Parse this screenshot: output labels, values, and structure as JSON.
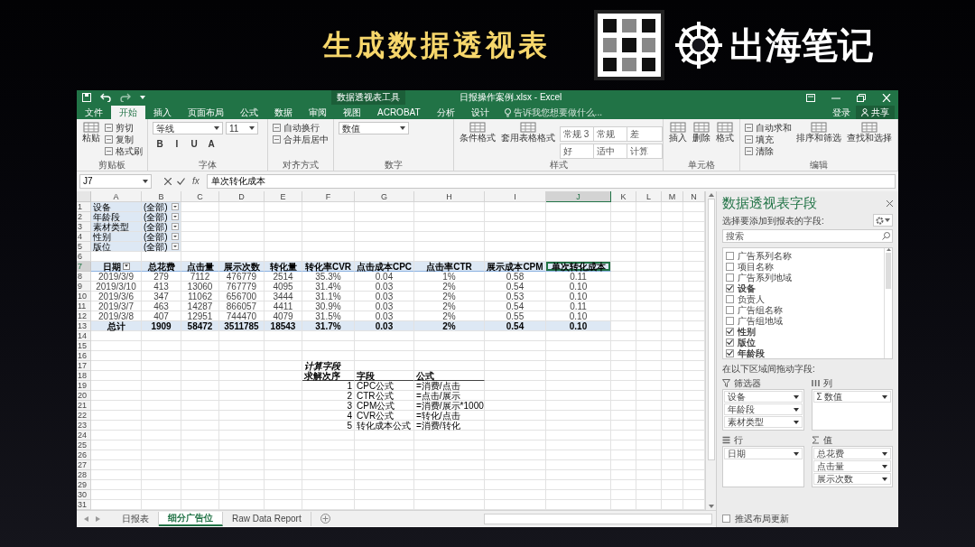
{
  "slide": {
    "title": "生成数据透视表",
    "logo_text": "出海笔记"
  },
  "window": {
    "context_group": "数据透视表工具",
    "title": "日报操作案例.xlsx - Excel"
  },
  "ribbon_tabs": [
    {
      "label": "文件",
      "selected": false
    },
    {
      "label": "开始",
      "selected": true
    },
    {
      "label": "插入",
      "selected": false
    },
    {
      "label": "页面布局",
      "selected": false
    },
    {
      "label": "公式",
      "selected": false
    },
    {
      "label": "数据",
      "selected": false
    },
    {
      "label": "审阅",
      "selected": false
    },
    {
      "label": "视图",
      "selected": false
    },
    {
      "label": "ACROBAT",
      "selected": false
    },
    {
      "label": "分析",
      "selected": false
    },
    {
      "label": "设计",
      "selected": false
    }
  ],
  "tell_me": {
    "placeholder": "告诉我您想要做什么..."
  },
  "account": {
    "sign_in": "登录",
    "share": "共享"
  },
  "ribbon_groups": [
    {
      "label": "剪贴板",
      "items": [
        {
          "kind": "large",
          "label": "粘贴"
        },
        {
          "kind": "small",
          "label": "剪切"
        },
        {
          "kind": "small",
          "label": "复制"
        },
        {
          "kind": "small",
          "label": "格式刷"
        }
      ]
    },
    {
      "label": "字体",
      "items": [
        {
          "kind": "field",
          "label": "等线"
        },
        {
          "kind": "field",
          "label": "11"
        },
        {
          "kind": "glyph",
          "label": "B"
        },
        {
          "kind": "glyph",
          "label": "I"
        },
        {
          "kind": "glyph",
          "label": "U"
        },
        {
          "kind": "glyph",
          "label": "A"
        }
      ]
    },
    {
      "label": "对齐方式",
      "items": [
        {
          "kind": "small",
          "label": "自动换行"
        },
        {
          "kind": "small",
          "label": "合并后居中"
        }
      ]
    },
    {
      "label": "数字",
      "items": [
        {
          "kind": "field",
          "label": "数值"
        }
      ]
    },
    {
      "label": "样式",
      "items": [
        {
          "kind": "large",
          "label": "条件格式"
        },
        {
          "kind": "large",
          "label": "套用表格格式"
        },
        {
          "kind": "style",
          "label": "常规 3"
        },
        {
          "kind": "style",
          "label": "常规"
        },
        {
          "kind": "style",
          "label": "差"
        },
        {
          "kind": "style",
          "label": "好"
        },
        {
          "kind": "style",
          "label": "适中"
        },
        {
          "kind": "style",
          "label": "计算"
        }
      ]
    },
    {
      "label": "单元格",
      "items": [
        {
          "kind": "large",
          "label": "插入"
        },
        {
          "kind": "large",
          "label": "删除"
        },
        {
          "kind": "large",
          "label": "格式"
        }
      ]
    },
    {
      "label": "编辑",
      "items": [
        {
          "kind": "small",
          "label": "自动求和"
        },
        {
          "kind": "small",
          "label": "填充"
        },
        {
          "kind": "small",
          "label": "清除"
        },
        {
          "kind": "large",
          "label": "排序和筛选"
        },
        {
          "kind": "large",
          "label": "查找和选择"
        }
      ]
    }
  ],
  "formula_bar": {
    "name_box": "J7",
    "fx": "fx",
    "value": "单次转化成本"
  },
  "sheet": {
    "column_headers": [
      "A",
      "B",
      "C",
      "D",
      "E",
      "F",
      "G",
      "H",
      "I",
      "J",
      "K",
      "L",
      "M",
      "N"
    ],
    "row_headers": [
      "1",
      "2",
      "3",
      "4",
      "5",
      "6",
      "7",
      "8",
      "9",
      "10",
      "11",
      "12",
      "13",
      "14",
      "15",
      "16",
      "17",
      "18",
      "19",
      "20",
      "21",
      "22",
      "23",
      "24",
      "25",
      "26",
      "27",
      "28",
      "29",
      "30",
      "31"
    ],
    "filters": [
      {
        "field": "设备",
        "value": "(全部)"
      },
      {
        "field": "年龄段",
        "value": "(全部)"
      },
      {
        "field": "素材类型",
        "value": "(全部)"
      },
      {
        "field": "性别",
        "value": "(全部)"
      },
      {
        "field": "版位",
        "value": "(全部)"
      }
    ],
    "pivot": {
      "columns": [
        {
          "label": "日期",
          "selected": false
        },
        {
          "label": "总花费",
          "selected": false
        },
        {
          "label": "点击量",
          "selected": false
        },
        {
          "label": "展示次数",
          "selected": false
        },
        {
          "label": "转化量",
          "selected": false
        },
        {
          "label": "转化率CVR",
          "selected": false
        },
        {
          "label": "点击成本CPC",
          "selected": false
        },
        {
          "label": "点击率CTR",
          "selected": false
        },
        {
          "label": "展示成本CPM",
          "selected": false
        },
        {
          "label": "单次转化成本",
          "selected": true
        }
      ],
      "rows": [
        [
          "2019/3/9",
          "279",
          "7112",
          "476779",
          "2514",
          "35.3%",
          "0.04",
          "1%",
          "0.58",
          "0.11"
        ],
        [
          "2019/3/10",
          "413",
          "13060",
          "767779",
          "4095",
          "31.4%",
          "0.03",
          "2%",
          "0.54",
          "0.10"
        ],
        [
          "2019/3/6",
          "347",
          "11062",
          "656700",
          "3444",
          "31.1%",
          "0.03",
          "2%",
          "0.53",
          "0.10"
        ],
        [
          "2019/3/7",
          "463",
          "14287",
          "866057",
          "4411",
          "30.9%",
          "0.03",
          "2%",
          "0.54",
          "0.11"
        ],
        [
          "2019/3/8",
          "407",
          "12951",
          "744470",
          "4079",
          "31.5%",
          "0.03",
          "2%",
          "0.55",
          "0.10"
        ]
      ],
      "total": [
        "总计",
        "1909",
        "58472",
        "3511785",
        "18543",
        "31.7%",
        "0.03",
        "2%",
        "0.54",
        "0.10"
      ]
    },
    "calc_fields": {
      "title": "计算字段",
      "headers": [
        "求解次序",
        "字段",
        "公式"
      ],
      "rows": [
        {
          "order": "1",
          "field": "CPC公式",
          "formula": "=消费/点击"
        },
        {
          "order": "2",
          "field": "CTR公式",
          "formula": "=点击/展示"
        },
        {
          "order": "3",
          "field": "CPM公式",
          "formula": "=消费/展示*1000"
        },
        {
          "order": "4",
          "field": "CVR公式",
          "formula": "=转化/点击"
        },
        {
          "order": "5",
          "field": "转化成本公式",
          "formula": "=消费/转化"
        }
      ]
    }
  },
  "sheet_tabs": [
    {
      "label": "日报表",
      "selected": false
    },
    {
      "label": "细分广告位",
      "selected": true
    },
    {
      "label": "Raw Data Report",
      "selected": false
    }
  ],
  "pivot_pane": {
    "title": "数据透视表字段",
    "subtitle": "选择要添加到报表的字段:",
    "search": {
      "placeholder": "搜索"
    },
    "fields": [
      {
        "label": "广告系列名称",
        "checked": false
      },
      {
        "label": "项目名称",
        "checked": false
      },
      {
        "label": "广告系列地域",
        "checked": false
      },
      {
        "label": "设备",
        "checked": true
      },
      {
        "label": "负责人",
        "checked": false
      },
      {
        "label": "广告组名称",
        "checked": false
      },
      {
        "label": "广告组地域",
        "checked": false
      },
      {
        "label": "性别",
        "checked": true
      },
      {
        "label": "版位",
        "checked": true
      },
      {
        "label": "年龄段",
        "checked": true
      }
    ],
    "areas_hint": "在以下区域间拖动字段:",
    "areas": [
      {
        "kind": "filters",
        "label": "筛选器",
        "items": [
          "设备",
          "年龄段",
          "素材类型"
        ]
      },
      {
        "kind": "columns",
        "label": "列",
        "items": [
          "Σ 数值"
        ]
      },
      {
        "kind": "rows",
        "label": "行",
        "items": [
          "日期"
        ]
      },
      {
        "kind": "values",
        "label": "值",
        "items": [
          "总花费",
          "点击量",
          "展示次数"
        ]
      }
    ],
    "defer_update": {
      "label": "推迟布局更新",
      "checked": false
    }
  }
}
